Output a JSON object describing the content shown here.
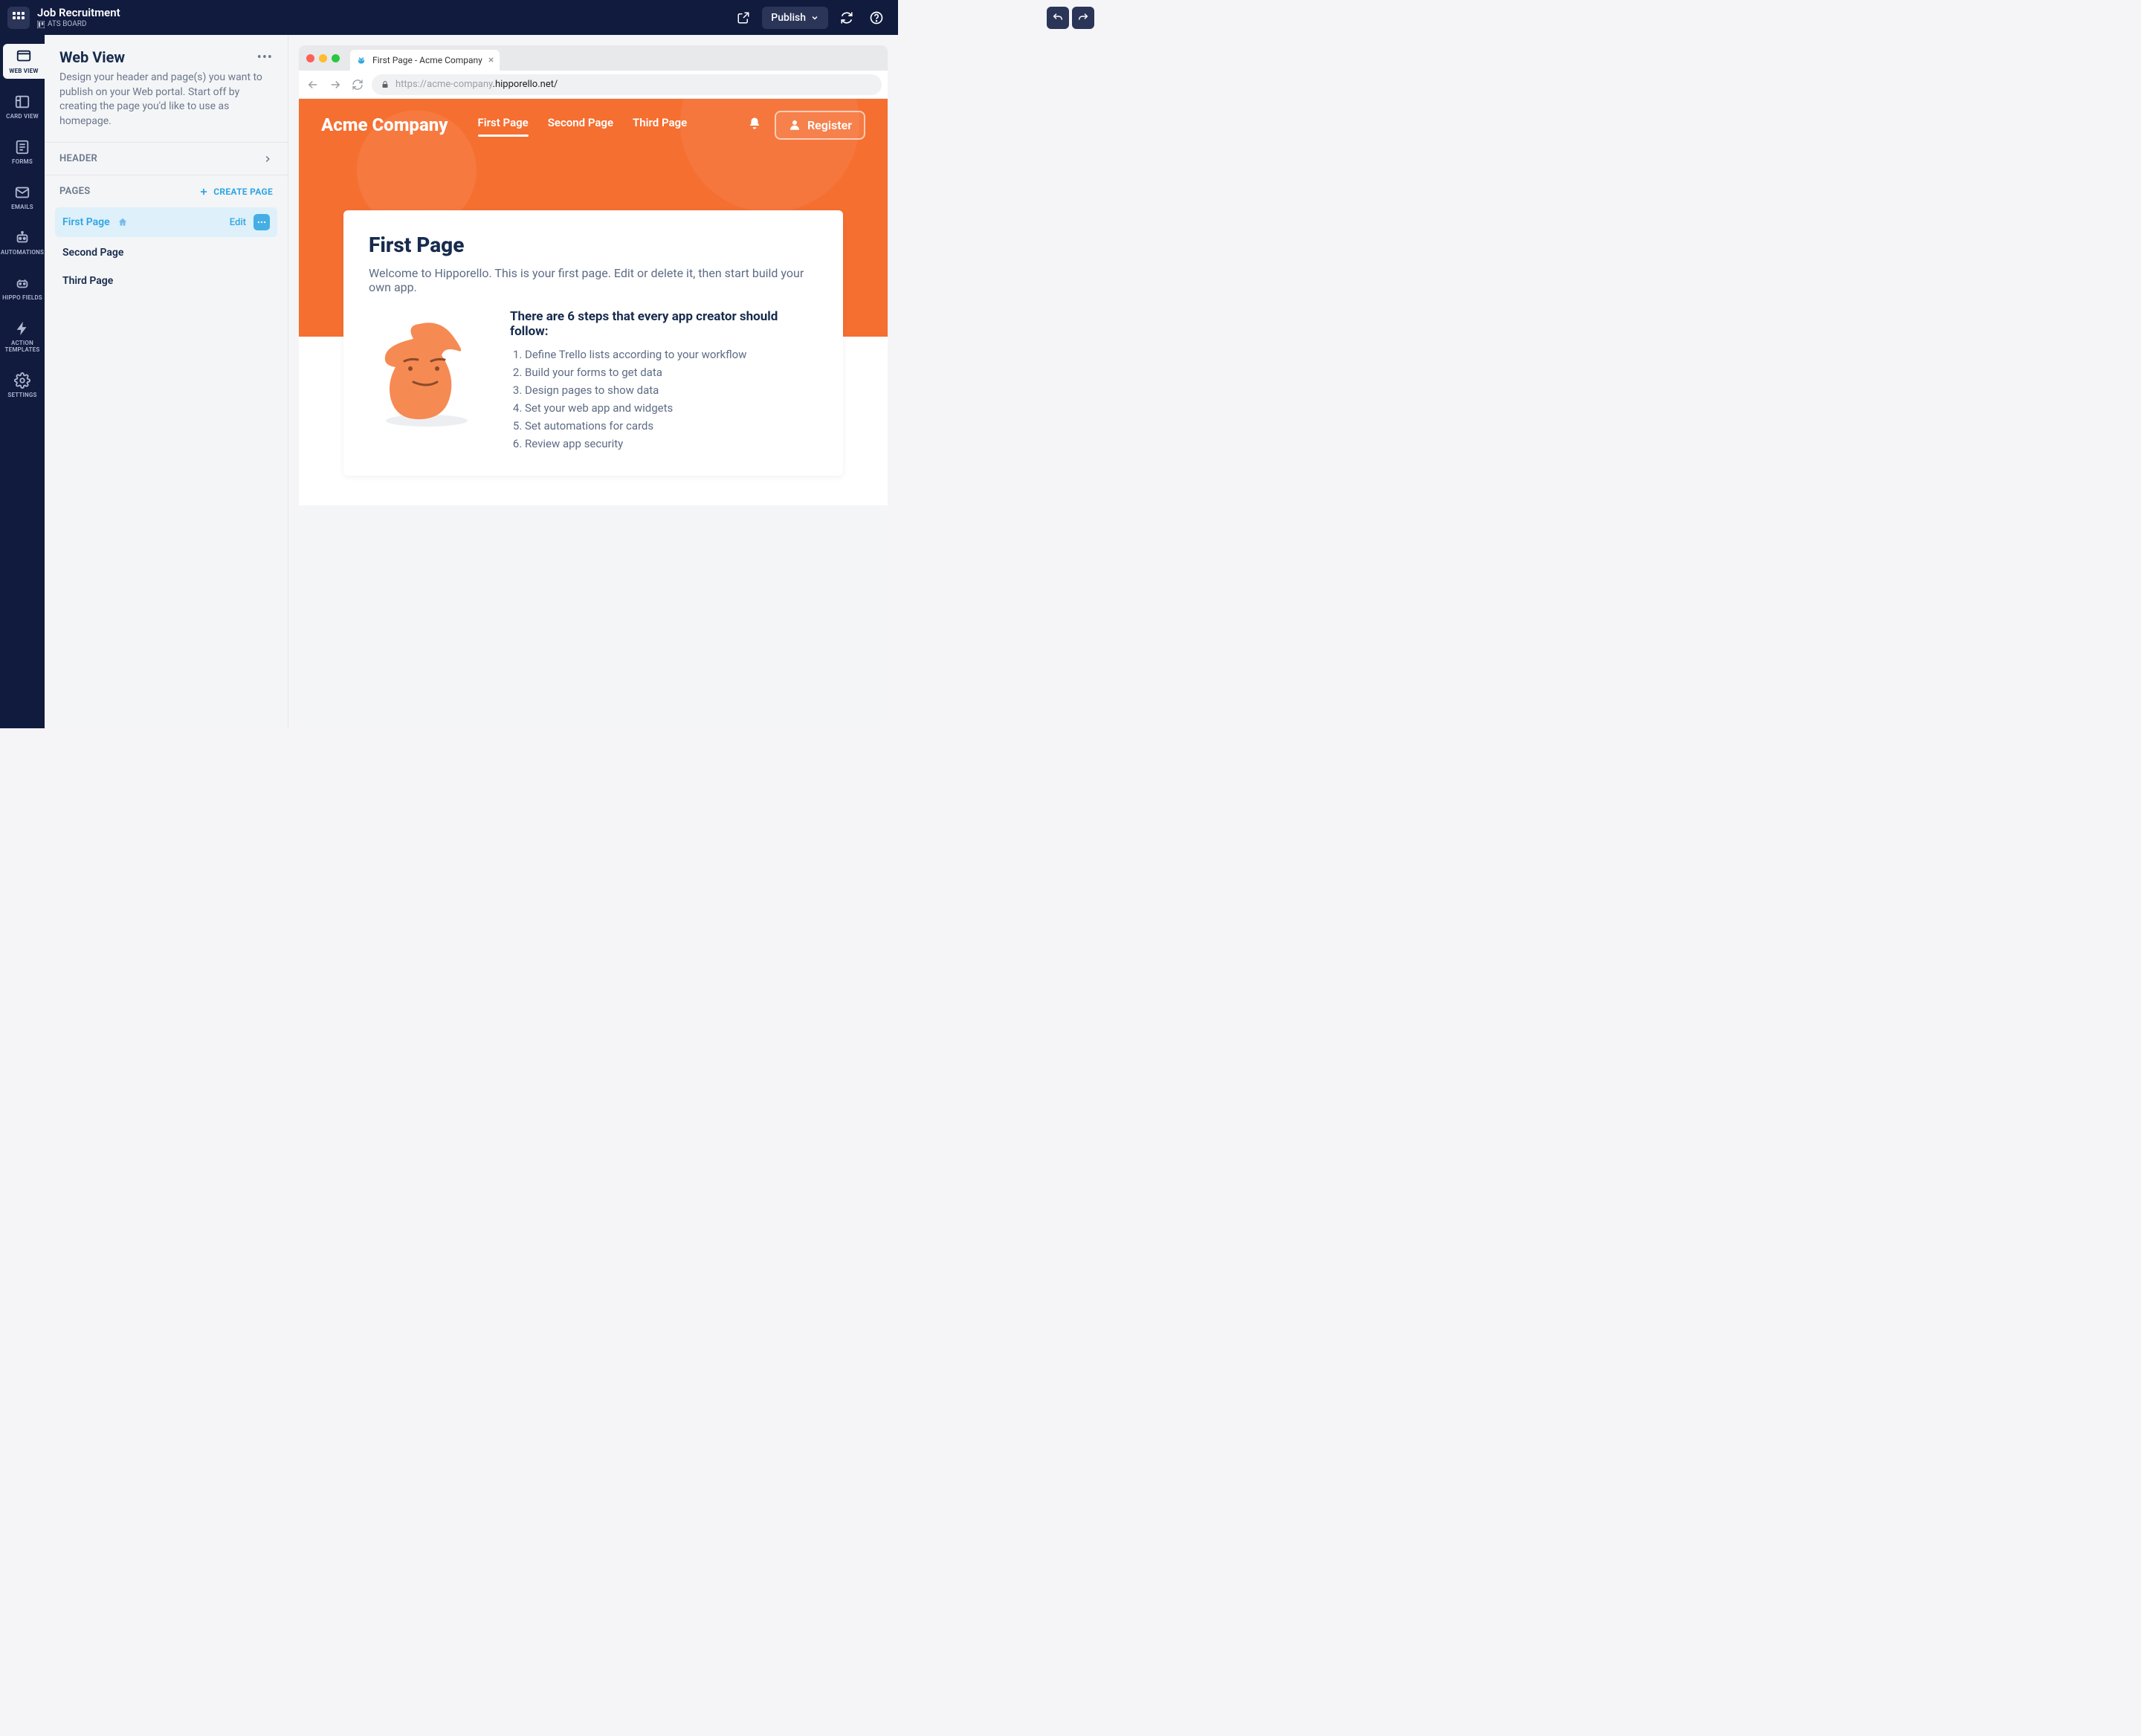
{
  "header": {
    "title": "Job Recruitment",
    "board_label": "ATS BOARD",
    "publish_label": "Publish"
  },
  "sidebar": {
    "items": [
      {
        "label": "WEB VIEW"
      },
      {
        "label": "CARD VIEW"
      },
      {
        "label": "FORMS"
      },
      {
        "label": "EMAILS"
      },
      {
        "label": "AUTOMATIONS"
      },
      {
        "label": "HIPPO FIELDS"
      },
      {
        "label": "ACTION TEMPLATES"
      },
      {
        "label": "SETTINGS"
      }
    ]
  },
  "panel": {
    "title": "Web View",
    "description": "Design your header and page(s) you want to publish on your Web portal. Start off by creating the page you'd like to use as homepage.",
    "header_section": "HEADER",
    "pages_section": "PAGES",
    "create_page": "CREATE PAGE",
    "edit_label": "Edit",
    "pages": [
      {
        "name": "First Page"
      },
      {
        "name": "Second Page"
      },
      {
        "name": "Third Page"
      }
    ]
  },
  "preview": {
    "tab_title": "First Page - Acme Company",
    "url_prefix": "https://acme-company",
    "url_suffix": ".hipporello.net/",
    "brand": "Acme Company",
    "nav": [
      {
        "label": "First Page"
      },
      {
        "label": "Second Page"
      },
      {
        "label": "Third Page"
      }
    ],
    "register_label": "Register",
    "page_title": "First Page",
    "welcome": "Welcome to Hipporello. This is your first page. Edit or delete it, then start build your own app.",
    "steps_heading": "There are 6 steps that every app creator should follow:",
    "steps": [
      "Define Trello lists according to your workflow",
      "Build your forms to get data",
      "Design pages to show data",
      "Set your web app and widgets",
      "Set automations for cards",
      "Review app security"
    ]
  }
}
